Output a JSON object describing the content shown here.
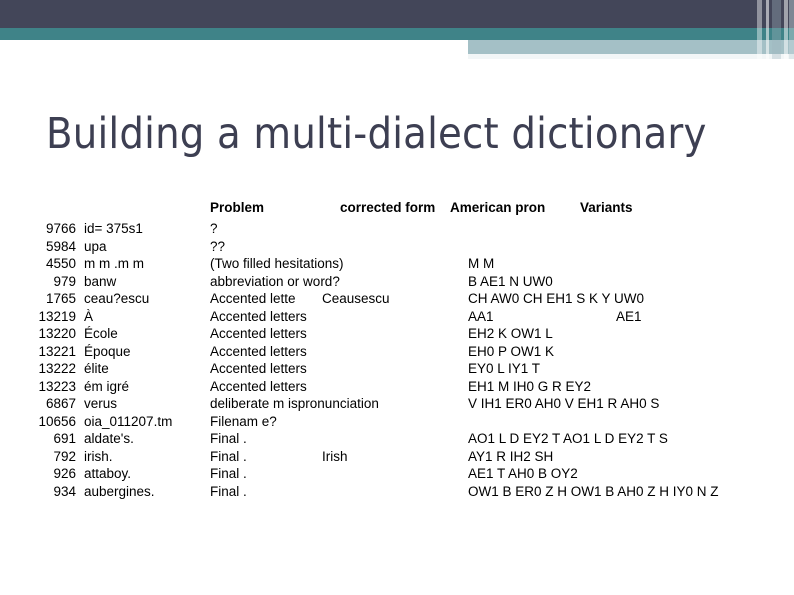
{
  "slide": {
    "title": "Building a multi-dialect dictionary"
  },
  "theme": {
    "dark_band": "#434659",
    "teal_band": "#3f8388",
    "light_blue_band": "#a4c0c6",
    "pale_band": "#f2f6f7",
    "title_color": "#3d3f52",
    "text_color": "#000000",
    "background": "#ffffff"
  },
  "table": {
    "headers": {
      "id": "",
      "problem": "Problem",
      "corrected_form": "corrected form",
      "american_pron": "American pron",
      "variants": "Variants"
    },
    "rows": [
      {
        "id": "9766",
        "word": "id= 375s1",
        "problem": "?",
        "corrected": "",
        "american_pron": "",
        "variants": ""
      },
      {
        "id": "5984",
        "word": "upa",
        "problem": "??",
        "corrected": "",
        "american_pron": "",
        "variants": ""
      },
      {
        "id": "4550",
        "word": "m m .m m",
        "problem": "(Two filled hesitations)",
        "corrected": "",
        "american_pron": "M M",
        "variants": ""
      },
      {
        "id": "979",
        "word": "banw",
        "problem": "abbreviation or word?",
        "corrected": "",
        "american_pron": "B AE1 N UW0",
        "variants": ""
      },
      {
        "id": "1765",
        "word": "ceau?escu",
        "problem": "Accented lette",
        "corrected": "Ceausescu",
        "american_pron": "CH AW0 CH EH1 S K Y UW0",
        "variants": ""
      },
      {
        "id": "13219",
        "word": "À",
        "problem": "Accented letters",
        "corrected": "",
        "american_pron": "AA1",
        "variants": "AE1"
      },
      {
        "id": "13220",
        "word": "École",
        "problem": "Accented letters",
        "corrected": "",
        "american_pron": "EH2 K OW1 L",
        "variants": ""
      },
      {
        "id": "13221",
        "word": "Époque",
        "problem": "Accented letters",
        "corrected": "",
        "american_pron": "EH0 P OW1 K",
        "variants": ""
      },
      {
        "id": "13222",
        "word": "élite",
        "problem": "Accented letters",
        "corrected": "",
        "american_pron": "EY0 L IY1 T",
        "variants": ""
      },
      {
        "id": "13223",
        "word": "ém igré",
        "problem": "Accented letters",
        "corrected": "",
        "american_pron": "EH1 M IH0 G R EY2",
        "variants": ""
      },
      {
        "id": "6867",
        "word": "verus",
        "problem": "deliberate m ispronunciation",
        "corrected": "",
        "american_pron": "V IH1 ER0 AH0 V EH1 R AH0 S",
        "variants": ""
      },
      {
        "id": "10656",
        "word": "oia_011207.tm",
        "problem": "Filenam e?",
        "corrected": "",
        "american_pron": "",
        "variants": ""
      },
      {
        "id": "691",
        "word": "aldate's.",
        "problem": "Final .",
        "corrected": "",
        "american_pron": "AO1 L D EY2 T AO1 L D EY2 T S",
        "variants": ""
      },
      {
        "id": "792",
        "word": "irish.",
        "problem": "Final .",
        "corrected": "Irish",
        "american_pron": "AY1 R IH2 SH",
        "variants": ""
      },
      {
        "id": "926",
        "word": "attaboy.",
        "problem": "Final .",
        "corrected": "",
        "american_pron": "AE1 T AH0 B OY2",
        "variants": ""
      },
      {
        "id": "934",
        "word": "aubergines.",
        "problem": "Final .",
        "corrected": "",
        "american_pron": "OW1 B ER0 Z H OW1 B AH0 Z H IY0 N Z",
        "variants": ""
      }
    ]
  }
}
